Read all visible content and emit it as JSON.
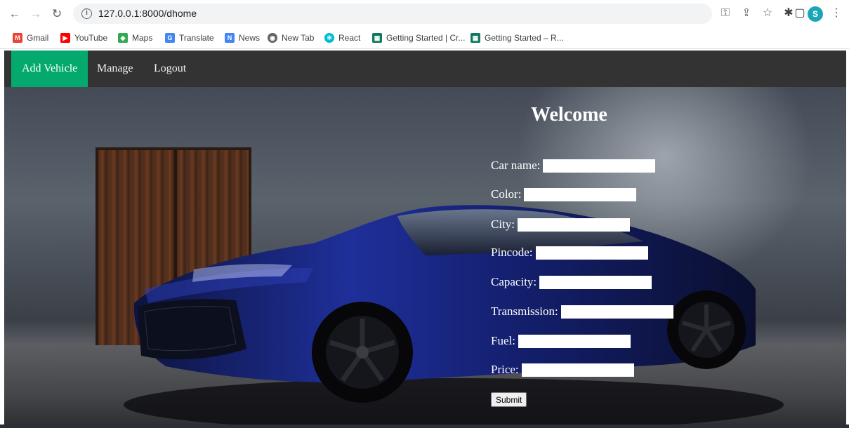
{
  "browser": {
    "url": "127.0.0.1:8000/dhome",
    "profile_initial": "S",
    "bookmarks": [
      {
        "label": "Gmail",
        "color": "#ea4335",
        "glyph": "M"
      },
      {
        "label": "YouTube",
        "color": "#ff0000",
        "glyph": "▶"
      },
      {
        "label": "Maps",
        "color": "#34a853",
        "glyph": "◆"
      },
      {
        "label": "Translate",
        "color": "#4285f4",
        "glyph": "G"
      },
      {
        "label": "News",
        "color": "#4285f4",
        "glyph": "N"
      },
      {
        "label": "New Tab",
        "color": "#5f6368",
        "glyph": "◉"
      },
      {
        "label": "React",
        "color": "#00bcd4",
        "glyph": "⚛"
      },
      {
        "label": "Getting Started | Cr...",
        "color": "#0f7a5f",
        "glyph": "▦"
      },
      {
        "label": "Getting Started – R...",
        "color": "#0f7a5f",
        "glyph": "▦"
      }
    ]
  },
  "navbar": {
    "items": [
      {
        "label": "Add Vehicle",
        "active": true
      },
      {
        "label": "Manage",
        "active": false
      },
      {
        "label": "Logout",
        "active": false
      }
    ],
    "active_color": "#04aa6d",
    "background_color": "#333333"
  },
  "page": {
    "heading": "Welcome"
  },
  "form": {
    "fields": [
      {
        "label": "Car name:",
        "value": ""
      },
      {
        "label": "Color:",
        "value": ""
      },
      {
        "label": "City:",
        "value": ""
      },
      {
        "label": "Pincode:",
        "value": ""
      },
      {
        "label": "Capacity:",
        "value": ""
      },
      {
        "label": "Transmission:",
        "value": ""
      },
      {
        "label": "Fuel:",
        "value": ""
      },
      {
        "label": "Price:",
        "value": ""
      }
    ],
    "submit_label": "Submit"
  }
}
